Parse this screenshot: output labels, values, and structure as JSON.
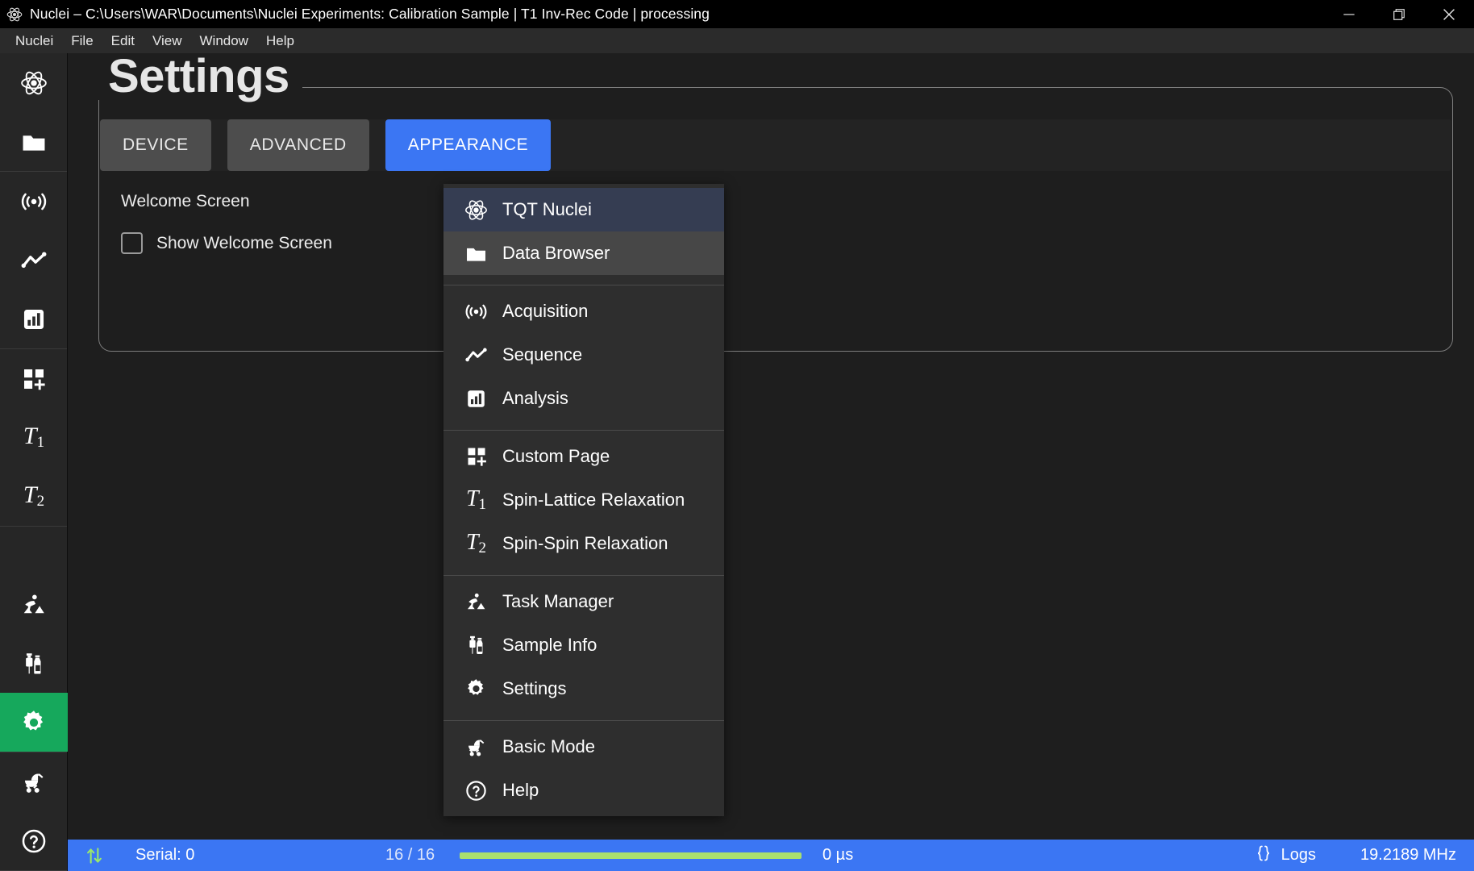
{
  "window": {
    "title": "Nuclei – C:\\Users\\WAR\\Documents\\Nuclei Experiments: Calibration Sample | T1 Inv-Rec Code | processing",
    "app_icon": "atom-icon",
    "controls": {
      "minimize": "minimize-icon",
      "restore": "restore-icon",
      "close": "close-icon"
    }
  },
  "menubar": {
    "items": [
      {
        "label": "Nuclei"
      },
      {
        "label": "File"
      },
      {
        "label": "Edit"
      },
      {
        "label": "View"
      },
      {
        "label": "Window"
      },
      {
        "label": "Help"
      }
    ]
  },
  "sidebar": {
    "groups": [
      {
        "items": [
          {
            "name": "tqt-nuclei",
            "icon": "atom-icon",
            "active": false
          },
          {
            "name": "data-browser",
            "icon": "folder-icon",
            "active": false
          }
        ]
      },
      {
        "items": [
          {
            "name": "acquisition",
            "icon": "broadcast-icon",
            "active": false
          },
          {
            "name": "sequence",
            "icon": "line-chart-icon",
            "active": false
          },
          {
            "name": "analysis",
            "icon": "bar-chart-icon",
            "active": false
          }
        ]
      },
      {
        "items": [
          {
            "name": "custom-page",
            "icon": "grid-plus-icon",
            "active": false
          },
          {
            "name": "spin-lattice-relaxation",
            "icon": "t1-icon",
            "active": false
          },
          {
            "name": "spin-spin-relaxation",
            "icon": "t2-icon",
            "active": false
          }
        ]
      },
      {
        "items": [
          {
            "name": "task-manager",
            "icon": "worker-icon",
            "active": false
          },
          {
            "name": "sample-info",
            "icon": "sample-vial-icon",
            "active": false
          },
          {
            "name": "settings",
            "icon": "gear-icon",
            "active": true
          }
        ]
      },
      {
        "items": [
          {
            "name": "basic-mode",
            "icon": "stroller-icon",
            "active": false
          },
          {
            "name": "help",
            "icon": "question-circle-icon",
            "active": false
          }
        ]
      }
    ]
  },
  "main": {
    "page_title": "Settings",
    "tabs": [
      {
        "label": "DEVICE",
        "active": false
      },
      {
        "label": "ADVANCED",
        "active": false
      },
      {
        "label": "APPEARANCE",
        "active": true
      }
    ],
    "sections": [
      {
        "label": "Welcome Screen",
        "checkbox": {
          "label": "Show Welcome Screen",
          "checked": false
        }
      }
    ]
  },
  "dropdown": {
    "groups": [
      {
        "items": [
          {
            "label": "TQT Nuclei",
            "icon": "atom-icon",
            "state": "selected"
          },
          {
            "label": "Data Browser",
            "icon": "folder-icon",
            "state": "hover"
          }
        ]
      },
      {
        "items": [
          {
            "label": "Acquisition",
            "icon": "broadcast-icon",
            "state": ""
          },
          {
            "label": "Sequence",
            "icon": "line-chart-icon",
            "state": ""
          },
          {
            "label": "Analysis",
            "icon": "bar-chart-icon",
            "state": ""
          }
        ]
      },
      {
        "items": [
          {
            "label": "Custom Page",
            "icon": "grid-plus-icon",
            "state": ""
          },
          {
            "label": "Spin-Lattice Relaxation",
            "icon": "t1-icon",
            "state": ""
          },
          {
            "label": "Spin-Spin Relaxation",
            "icon": "t2-icon",
            "state": ""
          }
        ]
      },
      {
        "items": [
          {
            "label": "Task Manager",
            "icon": "worker-icon",
            "state": ""
          },
          {
            "label": "Sample Info",
            "icon": "sample-vial-icon",
            "state": ""
          },
          {
            "label": "Settings",
            "icon": "gear-icon",
            "state": ""
          }
        ]
      },
      {
        "items": [
          {
            "label": "Basic Mode",
            "icon": "stroller-icon",
            "state": ""
          },
          {
            "label": "Help",
            "icon": "question-circle-icon",
            "state": ""
          }
        ]
      }
    ]
  },
  "statusbar": {
    "transfer_icon": "up-down-arrows-icon",
    "serial": "Serial: 0",
    "count": "16 / 16",
    "progress_percent": 100,
    "time": "0 µs",
    "logs_icon": "braces-icon",
    "logs": "Logs",
    "frequency": "19.2189 MHz"
  },
  "colors": {
    "accent_blue": "#3b76f3",
    "accent_green": "#16a85c",
    "progress_green": "#a9e06e",
    "panel": "#2e2e2e",
    "selected_row": "#353d52",
    "hover_row": "#474747"
  }
}
